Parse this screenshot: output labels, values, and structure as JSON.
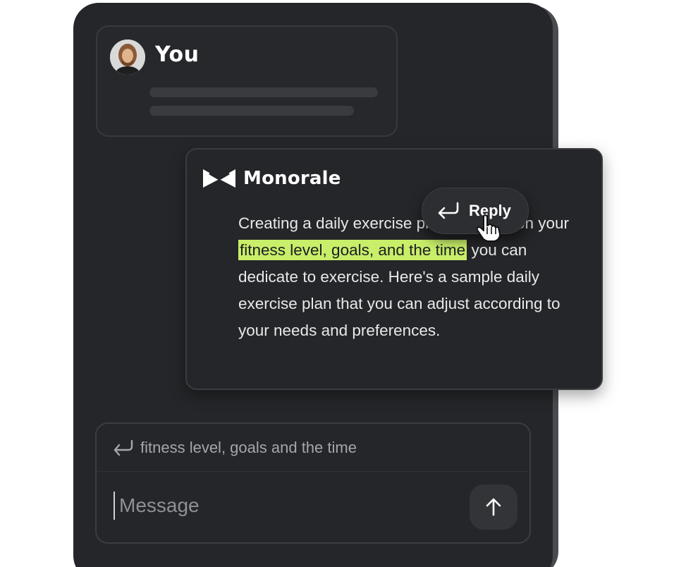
{
  "user_message": {
    "author": "You"
  },
  "assistant_message": {
    "brand": "Monorale",
    "text_before": "Creating a daily exercise plan depends on your ",
    "highlight": "fitness level, goals, and the time",
    "text_after": " you can dedicate to exercise. Here's a sample daily exercise plan that you can adjust according to your needs and preferences."
  },
  "reply_popup": {
    "label": "Reply",
    "icon": "reply-arrow-icon"
  },
  "composer": {
    "quoted_text": "fitness level, goals and the time",
    "placeholder": "Message",
    "send_icon": "arrow-up-icon"
  },
  "colors": {
    "background": "#252629",
    "highlight": "#c8ee6a",
    "text": "#e9e9ea"
  }
}
